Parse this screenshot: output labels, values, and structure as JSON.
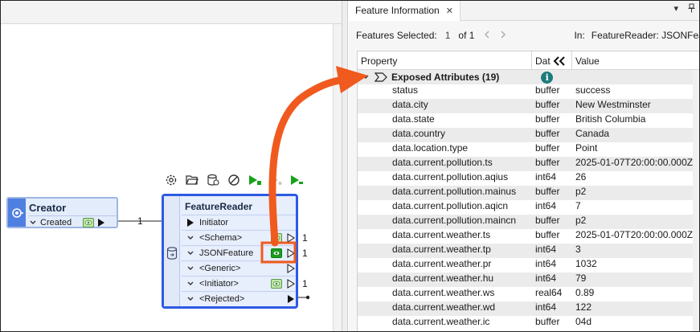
{
  "canvas": {
    "creator": {
      "title": "Creator",
      "port": "Created",
      "count": "1"
    },
    "reader": {
      "title": "FeatureReader",
      "ports": [
        {
          "label": "Initiator",
          "kind": "input"
        },
        {
          "label": "<Schema>",
          "kind": "output",
          "eye": "light",
          "count": "1"
        },
        {
          "label": "JSONFeature",
          "kind": "output",
          "eye": "dark",
          "count": "1"
        },
        {
          "label": "<Generic>",
          "kind": "output",
          "eye": "",
          "count": ""
        },
        {
          "label": "<Initiator>",
          "kind": "output",
          "eye": "light",
          "count": "1"
        },
        {
          "label": "<Rejected>",
          "kind": "rejected",
          "eye": "",
          "count": ""
        }
      ],
      "toolbar_icons": [
        "gear-icon",
        "folder-open-icon",
        "database-eye-icon",
        "disable-icon",
        "run-to-this-icon",
        "run-from-this-icon",
        "run-just-this-icon"
      ]
    },
    "accent_color": "#2d5be3",
    "annotation_color": "#f05a1e"
  },
  "panel": {
    "tab_label": "Feature Information",
    "close_glyph": "✕",
    "controls": [
      "▾",
      "ꟸ"
    ],
    "status": {
      "features_selected_label": "Features Selected:",
      "selected": "1",
      "of_label": "of 1",
      "in_label": "In:",
      "source": "FeatureReader: JSONFeatu"
    },
    "columns": {
      "property": "Property",
      "type": "Dat",
      "value": "Value"
    },
    "group": {
      "label": "Exposed Attributes (19)"
    },
    "rows": [
      {
        "name": "status",
        "type": "buffer",
        "value": "success"
      },
      {
        "name": "data.city",
        "type": "buffer",
        "value": "New Westminster"
      },
      {
        "name": "data.state",
        "type": "buffer",
        "value": "British Columbia"
      },
      {
        "name": "data.country",
        "type": "buffer",
        "value": "Canada"
      },
      {
        "name": "data.location.type",
        "type": "buffer",
        "value": "Point"
      },
      {
        "name": "data.current.pollution.ts",
        "type": "buffer",
        "value": "2025-01-07T20:00:00.000Z"
      },
      {
        "name": "data.current.pollution.aqius",
        "type": "int64",
        "value": "26"
      },
      {
        "name": "data.current.pollution.mainus",
        "type": "buffer",
        "value": "p2"
      },
      {
        "name": "data.current.pollution.aqicn",
        "type": "int64",
        "value": "7"
      },
      {
        "name": "data.current.pollution.maincn",
        "type": "buffer",
        "value": "p2"
      },
      {
        "name": "data.current.weather.ts",
        "type": "buffer",
        "value": "2025-01-07T20:00:00.000Z"
      },
      {
        "name": "data.current.weather.tp",
        "type": "int64",
        "value": "3"
      },
      {
        "name": "data.current.weather.pr",
        "type": "int64",
        "value": "1032"
      },
      {
        "name": "data.current.weather.hu",
        "type": "int64",
        "value": "79"
      },
      {
        "name": "data.current.weather.ws",
        "type": "real64",
        "value": "0.89"
      },
      {
        "name": "data.current.weather.wd",
        "type": "int64",
        "value": "122"
      },
      {
        "name": "data.current.weather.ic",
        "type": "buffer",
        "value": "04d"
      }
    ]
  }
}
